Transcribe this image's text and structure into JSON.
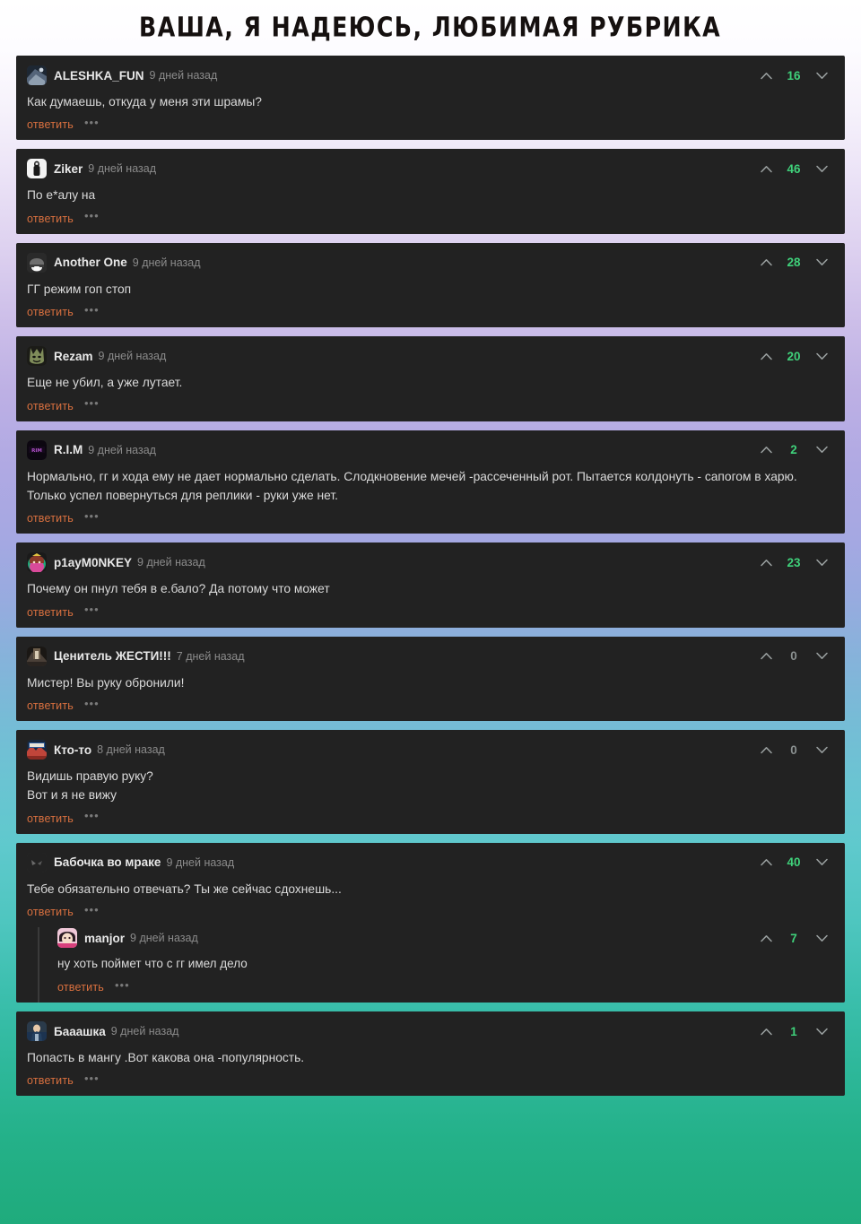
{
  "header": {
    "title": "ВАША, Я НАДЕЮСЬ, ЛЮБИМАЯ РУБРИКА"
  },
  "labels": {
    "reply": "ответить",
    "more": "•••"
  },
  "colors": {
    "card_bg": "#222222",
    "vote_positive": "#3fd07a",
    "vote_zero": "#8a9090",
    "reply_link": "#d9703f",
    "author": "#e8e8e8",
    "timestamp": "#8b8b8b",
    "body_text": "#dadada"
  },
  "comments": [
    {
      "author": "ALESHKA_FUN",
      "time": "9 дней назад",
      "votes": "16",
      "text": "Как думаешь, откуда у меня эти шрамы?",
      "avatar": "avatar-aleshka-fun",
      "replies": []
    },
    {
      "author": "Ziker",
      "time": "9 дней назад",
      "votes": "46",
      "text": "По е*алу на",
      "avatar": "avatar-ziker",
      "replies": []
    },
    {
      "author": "Another One",
      "time": "9 дней назад",
      "votes": "28",
      "text": "ГГ режим гоп стоп",
      "avatar": "avatar-another-one",
      "replies": []
    },
    {
      "author": "Rezam",
      "time": "9 дней назад",
      "votes": "20",
      "text": "Еще не убил, а уже лутает.",
      "avatar": "avatar-rezam",
      "replies": []
    },
    {
      "author": "R.I.M",
      "time": "9 дней назад",
      "votes": "2",
      "text": "Нормально, гг и хода ему не дает нормально сделать. Слодкновение мечей -рассеченный рот. Пытается колдонуть - сапогом в харю. Только успел повернуться для реплики - руки уже нет.",
      "avatar": "avatar-rim",
      "replies": []
    },
    {
      "author": "p1ayM0NKEY",
      "time": "9 дней назад",
      "votes": "23",
      "text": "Почему он пнул тебя в е.бало? Да потому что может",
      "avatar": "avatar-p1aymonkey",
      "replies": []
    },
    {
      "author": "Ценитель ЖЕСТИ!!!",
      "time": "7 дней назад",
      "votes": "0",
      "text": "Мистер! Вы руку обронили!",
      "avatar": "avatar-cenitel-zhesti",
      "replies": []
    },
    {
      "author": "Кто-то",
      "time": "8 дней назад",
      "votes": "0",
      "text": "Видишь правую руку?\nВот и я не вижу",
      "avatar": "avatar-kto-to",
      "replies": []
    },
    {
      "author": "Бабочка во мраке",
      "time": "9 дней назад",
      "votes": "40",
      "text": "Тебе обязательно отвечать? Ты же сейчас сдохнешь...",
      "avatar": "avatar-babochka-vo-mrake",
      "replies": [
        {
          "author": "manjor",
          "time": "9 дней назад",
          "votes": "7",
          "text": "ну хоть поймет что с гг имел дело",
          "avatar": "avatar-manjor"
        }
      ]
    },
    {
      "author": "Бааашка",
      "time": "9 дней назад",
      "votes": "1",
      "text": "Попасть в мангу .Вот какова она -популярность.",
      "avatar": "avatar-baaashka",
      "replies": []
    }
  ]
}
